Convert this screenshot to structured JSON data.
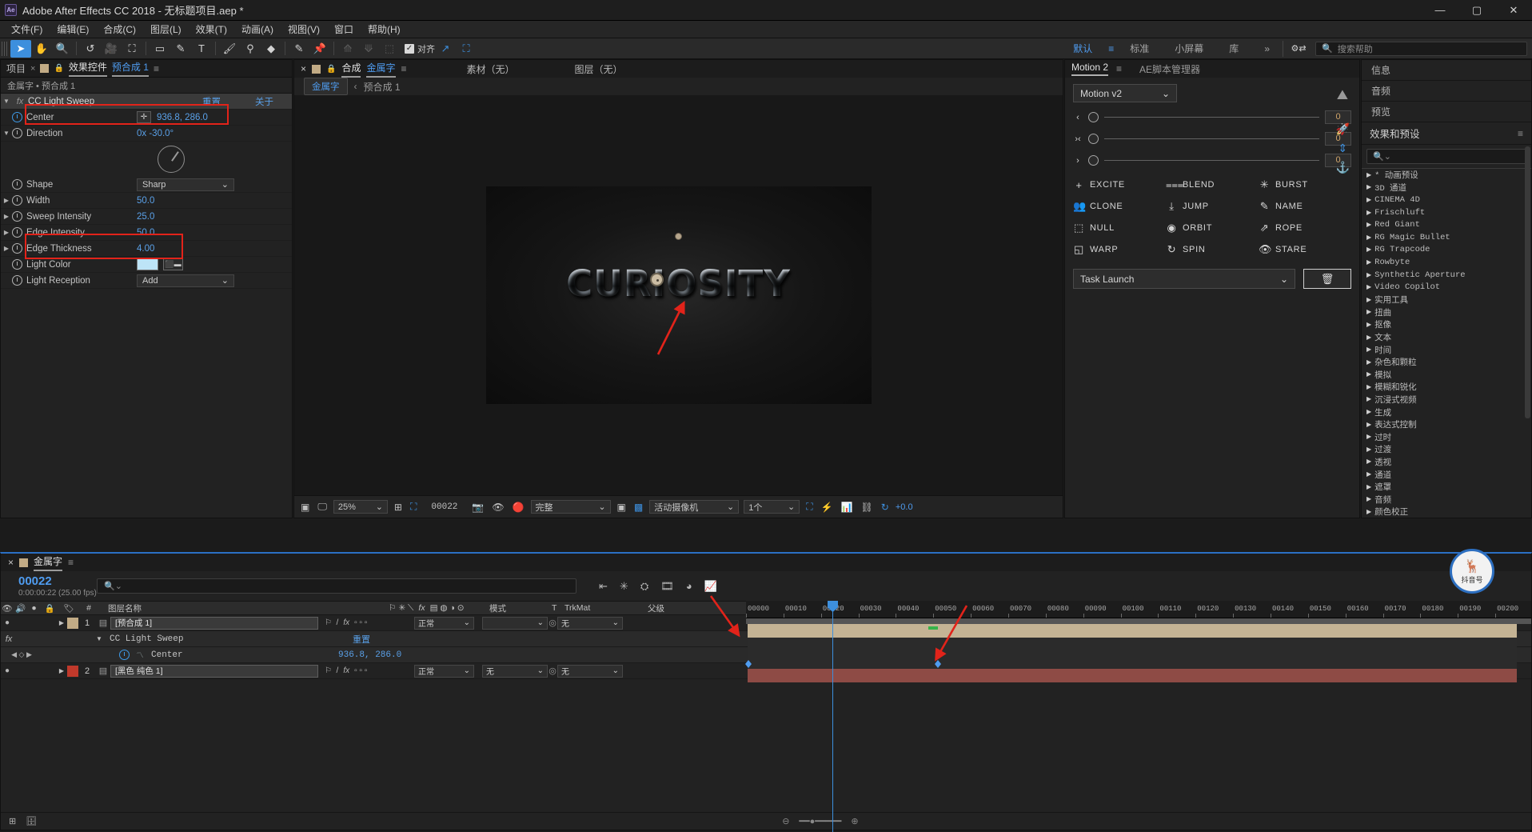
{
  "window": {
    "title": "Adobe After Effects CC 2018 - 无标题项目.aep *",
    "logo": "Ae",
    "minimize": "—",
    "maximize": "▢",
    "close": "✕"
  },
  "menu": [
    "文件(F)",
    "编辑(E)",
    "合成(C)",
    "图层(L)",
    "效果(T)",
    "动画(A)",
    "视图(V)",
    "窗口",
    "帮助(H)"
  ],
  "toolbar": {
    "tools": [
      "➤",
      "✋",
      "🔍",
      "↺",
      "🎥",
      "⛶",
      "▭",
      "✎",
      "T",
      "🖌",
      "⚲",
      "◆",
      "✎",
      "📌"
    ],
    "dim_tools": [
      "⟰",
      "⟱",
      "⬚"
    ],
    "align_label": "对齐",
    "align_checked": "✓",
    "extra": [
      "↗",
      "⛶"
    ],
    "workspaces": [
      {
        "label": "默认",
        "active": true
      },
      {
        "label": "标准",
        "active": false
      },
      {
        "label": "小屏幕",
        "active": false
      },
      {
        "label": "库",
        "active": false
      }
    ],
    "more": "»",
    "gear_icon": "⚙⇄",
    "help_placeholder": "搜索帮助",
    "help_icon": "search-icon"
  },
  "effect_controls": {
    "tab_project": "项目",
    "tab_effects": "效果控件",
    "tab_comp_name": "预合成 1",
    "close": "×",
    "menu": "≡",
    "breadcrumb": "金属字 • 预合成 1",
    "header": {
      "name": "CC Light Sweep",
      "reset": "重置",
      "about": "关于"
    },
    "properties": [
      {
        "name": "Center",
        "value": "936.8, 286.0",
        "kind": "position",
        "keyed": true
      },
      {
        "name": "Direction",
        "value": "0x -30.0°",
        "kind": "angle",
        "keyed": false
      },
      {
        "name": "Shape",
        "value": "Sharp",
        "kind": "dropdown",
        "keyed": false
      },
      {
        "name": "Width",
        "value": "50.0",
        "kind": "number",
        "keyed": false
      },
      {
        "name": "Sweep Intensity",
        "value": "25.0",
        "kind": "number",
        "keyed": false
      },
      {
        "name": "Edge Intensity",
        "value": "50.0",
        "kind": "number",
        "keyed": false
      },
      {
        "name": "Edge Thickness",
        "value": "4.00",
        "kind": "number",
        "keyed": false
      },
      {
        "name": "Light Color",
        "value": "",
        "kind": "color",
        "keyed": false
      },
      {
        "name": "Light Reception",
        "value": "Add",
        "kind": "dropdown",
        "keyed": false
      }
    ],
    "light_color_hex": "#bde4f7",
    "highlight_color": "#e2231a"
  },
  "composition": {
    "tab_close": "×",
    "tab_label": "合成",
    "tab_name": "金属字",
    "menu": "≡",
    "tab_footage": "素材（无）",
    "tab_layer": "图层（无）",
    "breadcrumb_active": "金属字",
    "breadcrumb_sep": "‹",
    "breadcrumb_child": "预合成 1",
    "artwork_text": "CURIOSITY",
    "bottom_bar": {
      "zoom": "25%",
      "frame": "00022",
      "quality": "完整",
      "camera": "活动摄像机",
      "views": "1个",
      "exposure": "+0.0"
    }
  },
  "motion2": {
    "tab_active": "Motion 2",
    "tab_menu": "≡",
    "tab_other": "AE脚本管理器",
    "preset": "Motion v2",
    "preset_chevron": "⌄",
    "sliders": [
      {
        "icon": "‹",
        "value": "0"
      },
      {
        "icon": "›‹",
        "value": "0"
      },
      {
        "icon": "›",
        "value": "0"
      }
    ],
    "side_icons": [
      "rocket-icon",
      "arrows-vertical-icon",
      "anchor-icon"
    ],
    "buttons": [
      {
        "label": "EXCITE",
        "icon": "+"
      },
      {
        "label": "BLEND",
        "icon": "⩶"
      },
      {
        "label": "BURST",
        "icon": "✳"
      },
      {
        "label": "CLONE",
        "icon": "👥"
      },
      {
        "label": "JUMP",
        "icon": "⤓"
      },
      {
        "label": "NAME",
        "icon": "✎"
      },
      {
        "label": "NULL",
        "icon": "⬚"
      },
      {
        "label": "ORBIT",
        "icon": "◉"
      },
      {
        "label": "ROPE",
        "icon": "⇗"
      },
      {
        "label": "WARP",
        "icon": "◱"
      },
      {
        "label": "SPIN",
        "icon": "↻"
      },
      {
        "label": "STARE",
        "icon": "👁"
      }
    ],
    "task_launch": "Task Launch",
    "task_chevron": "⌄",
    "trash_icon": "🗑"
  },
  "right_dock": {
    "tabs": [
      "信息",
      "音频",
      "预览"
    ],
    "effects_title": "效果和预设",
    "effects_menu": "≡",
    "search_placeholder": "",
    "search_icon": "search-icon",
    "categories": [
      "* 动画预设",
      "3D 通道",
      "CINEMA 4D",
      "Frischluft",
      "Red Giant",
      "RG Magic Bullet",
      "RG Trapcode",
      "Rowbyte",
      "Synthetic Aperture",
      "Video Copilot",
      "实用工具",
      "扭曲",
      "抠像",
      "文本",
      "时间",
      "杂色和颗粒",
      "模拟",
      "模糊和锐化",
      "沉浸式视频",
      "生成",
      "表达式控制",
      "过时",
      "过渡",
      "透视",
      "通道",
      "遮罩",
      "音频",
      "颜色校正"
    ]
  },
  "timeline": {
    "tab_name": "金属字",
    "tab_close": "×",
    "tab_menu": "≡",
    "current_frame": "00022",
    "timecode": "0:00:00:22 (25.00 fps)",
    "search_placeholder": "",
    "columns": {
      "layer_name": "图层名称",
      "mode": "模式",
      "trkmat_t": "T",
      "trkmat": "TrkMat",
      "parent": "父级"
    },
    "rows": [
      {
        "type": "layer",
        "num": "1",
        "name": "[预合成 1]",
        "mode": "正常",
        "trkmat": "",
        "parent": "无",
        "color": "#c2ab85"
      },
      {
        "type": "effect",
        "name": "CC Light Sweep",
        "value": "重置"
      },
      {
        "type": "property",
        "name": "Center",
        "value": "936.8, 286.0"
      },
      {
        "type": "layer",
        "num": "2",
        "name": "[黑色 纯色 1]",
        "mode": "正常",
        "trkmat": "无",
        "parent": "无",
        "color": "#c0392b"
      }
    ],
    "ruler_ticks": [
      "00000",
      "00010",
      "00020",
      "00030",
      "00040",
      "00050",
      "00060",
      "00070",
      "00080",
      "00090",
      "00100",
      "00110",
      "00120",
      "00130",
      "00140",
      "00150",
      "00160",
      "00170",
      "00180",
      "00190",
      "00200"
    ],
    "watermark": "抖音号"
  },
  "colors": {
    "accent_blue": "#3d8fdd",
    "value_blue": "#5aa0e8",
    "annotation_red": "#e2231a",
    "panel_bg": "#222222"
  }
}
